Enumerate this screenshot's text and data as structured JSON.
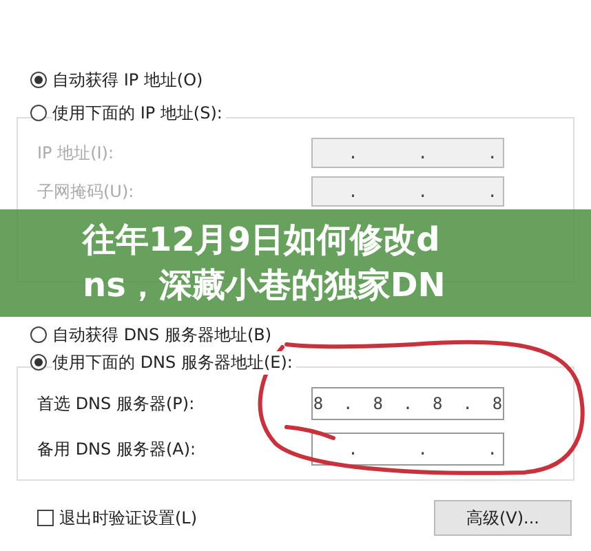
{
  "ip_options": [
    {
      "label": "自动获得 IP 地址(O)",
      "selected": true
    },
    {
      "label": "使用下面的 IP 地址(S):",
      "selected": false
    }
  ],
  "ip_fields": [
    {
      "label": "IP 地址(I):",
      "value": "   .      .      .",
      "disabled": true
    },
    {
      "label": "子网掩码(U):",
      "value": "   .      .      .",
      "disabled": true
    }
  ],
  "dns_options": [
    {
      "label": "自动获得 DNS 服务器地址(B)",
      "selected": false
    },
    {
      "label": "使用下面的 DNS 服务器地址(E):",
      "selected": true
    }
  ],
  "dns_fields": [
    {
      "label": "首选 DNS 服务器(P):",
      "value": "8  .  8  .  8  .  8",
      "disabled": false
    },
    {
      "label": "备用 DNS 服务器(A):",
      "value": "   .      .      .",
      "disabled": false
    }
  ],
  "validate_checkbox": {
    "label": "退出时验证设置(L)",
    "checked": false
  },
  "advanced_button": "高级(V)...",
  "banner": {
    "lines": [
      "往年12月9日如何修改d",
      "ns，深藏小巷的独家DN"
    ]
  }
}
